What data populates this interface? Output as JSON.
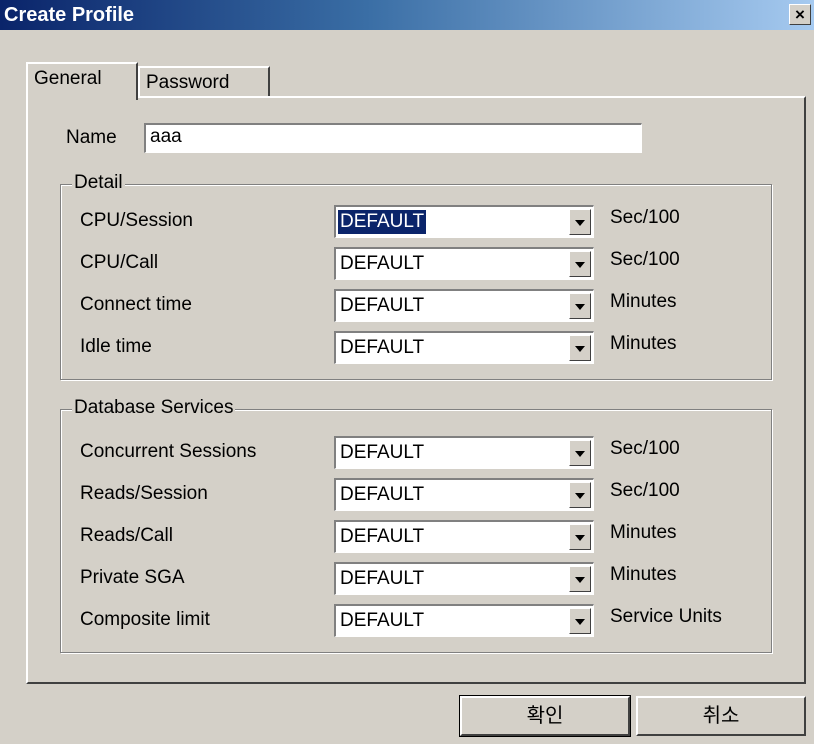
{
  "window": {
    "title": "Create Profile",
    "close_label": "×"
  },
  "tabs": [
    {
      "label": "General",
      "active": true
    },
    {
      "label": "Password",
      "active": false
    }
  ],
  "name_field": {
    "label": "Name",
    "value": "aaa"
  },
  "detail": {
    "title": "Detail",
    "rows": [
      {
        "label": "CPU/Session",
        "value": "DEFAULT",
        "unit": "Sec/100",
        "selected": true
      },
      {
        "label": "CPU/Call",
        "value": "DEFAULT",
        "unit": "Sec/100"
      },
      {
        "label": "Connect time",
        "value": "DEFAULT",
        "unit": "Minutes"
      },
      {
        "label": "Idle time",
        "value": "DEFAULT",
        "unit": "Minutes"
      }
    ]
  },
  "db_services": {
    "title": "Database Services",
    "rows": [
      {
        "label": "Concurrent Sessions",
        "value": "DEFAULT",
        "unit": "Sec/100"
      },
      {
        "label": "Reads/Session",
        "value": "DEFAULT",
        "unit": "Sec/100"
      },
      {
        "label": "Reads/Call",
        "value": "DEFAULT",
        "unit": "Minutes"
      },
      {
        "label": "Private SGA",
        "value": "DEFAULT",
        "unit": "Minutes"
      },
      {
        "label": "Composite limit",
        "value": "DEFAULT",
        "unit": "Service Units"
      }
    ]
  },
  "buttons": {
    "ok": "확인",
    "cancel": "취소"
  },
  "colors": {
    "title_start": "#0a246a",
    "title_end": "#a6caf0",
    "face": "#d4d0c8",
    "selection": "#0a246a"
  }
}
